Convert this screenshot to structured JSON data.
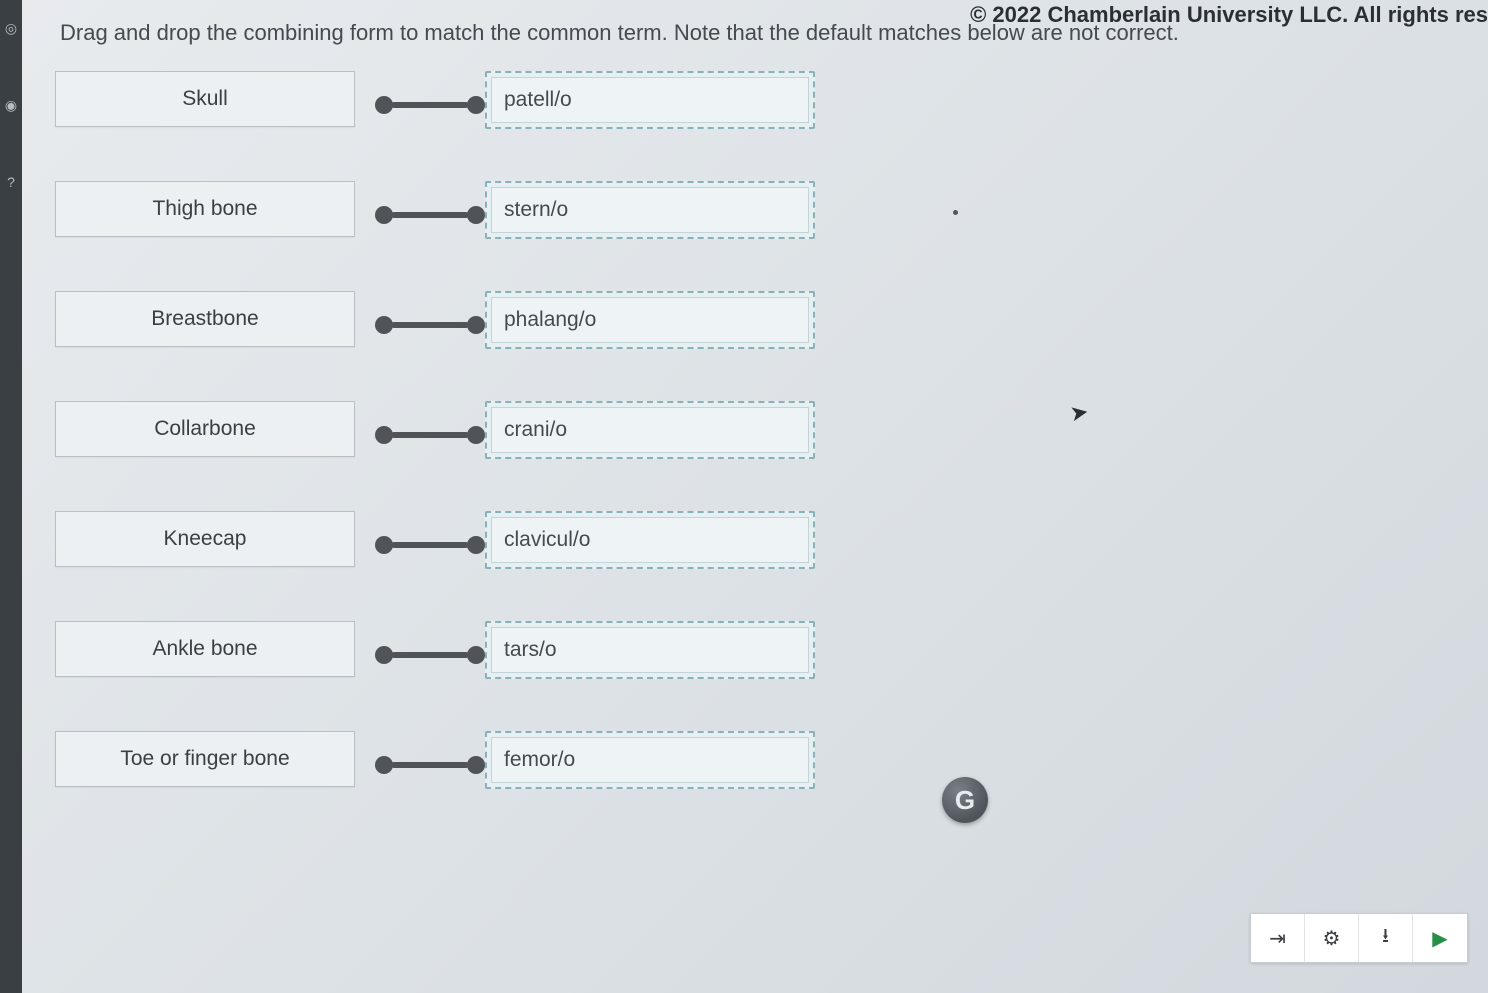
{
  "copyright": "© 2022 Chamberlain University LLC. All rights res",
  "instruction": "Drag and drop the combining form to match the common term. Note that the default matches below are not correct.",
  "pairs": [
    {
      "term": "Skull",
      "form": "patell/o"
    },
    {
      "term": "Thigh bone",
      "form": "stern/o"
    },
    {
      "term": "Breastbone",
      "form": "phalang/o"
    },
    {
      "term": "Collarbone",
      "form": "crani/o"
    },
    {
      "term": "Kneecap",
      "form": "clavicul/o"
    },
    {
      "term": "Ankle bone",
      "form": "tars/o"
    },
    {
      "term": "Toe or finger bone",
      "form": "femor/o"
    }
  ],
  "badge": "G",
  "toolbar": {
    "next": "⇥",
    "settings": "⚙",
    "download": "⭳",
    "play": "▶"
  }
}
